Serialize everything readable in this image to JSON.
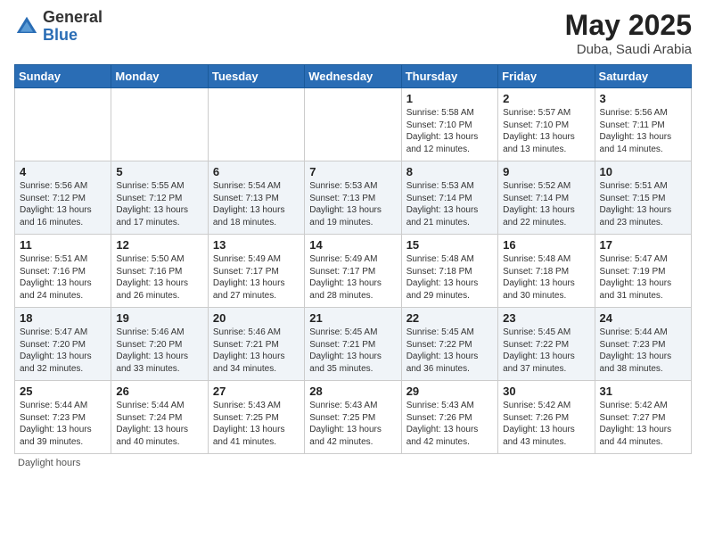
{
  "header": {
    "logo_general": "General",
    "logo_blue": "Blue",
    "month_title": "May 2025",
    "location": "Duba, Saudi Arabia"
  },
  "footer": {
    "daylight_label": "Daylight hours"
  },
  "days_of_week": [
    "Sunday",
    "Monday",
    "Tuesday",
    "Wednesday",
    "Thursday",
    "Friday",
    "Saturday"
  ],
  "weeks": [
    [
      {
        "num": "",
        "sunrise": "",
        "sunset": "",
        "daylight": ""
      },
      {
        "num": "",
        "sunrise": "",
        "sunset": "",
        "daylight": ""
      },
      {
        "num": "",
        "sunrise": "",
        "sunset": "",
        "daylight": ""
      },
      {
        "num": "",
        "sunrise": "",
        "sunset": "",
        "daylight": ""
      },
      {
        "num": "1",
        "sunrise": "5:58 AM",
        "sunset": "7:10 PM",
        "daylight": "13 hours and 12 minutes."
      },
      {
        "num": "2",
        "sunrise": "5:57 AM",
        "sunset": "7:10 PM",
        "daylight": "13 hours and 13 minutes."
      },
      {
        "num": "3",
        "sunrise": "5:56 AM",
        "sunset": "7:11 PM",
        "daylight": "13 hours and 14 minutes."
      }
    ],
    [
      {
        "num": "4",
        "sunrise": "5:56 AM",
        "sunset": "7:12 PM",
        "daylight": "13 hours and 16 minutes."
      },
      {
        "num": "5",
        "sunrise": "5:55 AM",
        "sunset": "7:12 PM",
        "daylight": "13 hours and 17 minutes."
      },
      {
        "num": "6",
        "sunrise": "5:54 AM",
        "sunset": "7:13 PM",
        "daylight": "13 hours and 18 minutes."
      },
      {
        "num": "7",
        "sunrise": "5:53 AM",
        "sunset": "7:13 PM",
        "daylight": "13 hours and 19 minutes."
      },
      {
        "num": "8",
        "sunrise": "5:53 AM",
        "sunset": "7:14 PM",
        "daylight": "13 hours and 21 minutes."
      },
      {
        "num": "9",
        "sunrise": "5:52 AM",
        "sunset": "7:14 PM",
        "daylight": "13 hours and 22 minutes."
      },
      {
        "num": "10",
        "sunrise": "5:51 AM",
        "sunset": "7:15 PM",
        "daylight": "13 hours and 23 minutes."
      }
    ],
    [
      {
        "num": "11",
        "sunrise": "5:51 AM",
        "sunset": "7:16 PM",
        "daylight": "13 hours and 24 minutes."
      },
      {
        "num": "12",
        "sunrise": "5:50 AM",
        "sunset": "7:16 PM",
        "daylight": "13 hours and 26 minutes."
      },
      {
        "num": "13",
        "sunrise": "5:49 AM",
        "sunset": "7:17 PM",
        "daylight": "13 hours and 27 minutes."
      },
      {
        "num": "14",
        "sunrise": "5:49 AM",
        "sunset": "7:17 PM",
        "daylight": "13 hours and 28 minutes."
      },
      {
        "num": "15",
        "sunrise": "5:48 AM",
        "sunset": "7:18 PM",
        "daylight": "13 hours and 29 minutes."
      },
      {
        "num": "16",
        "sunrise": "5:48 AM",
        "sunset": "7:18 PM",
        "daylight": "13 hours and 30 minutes."
      },
      {
        "num": "17",
        "sunrise": "5:47 AM",
        "sunset": "7:19 PM",
        "daylight": "13 hours and 31 minutes."
      }
    ],
    [
      {
        "num": "18",
        "sunrise": "5:47 AM",
        "sunset": "7:20 PM",
        "daylight": "13 hours and 32 minutes."
      },
      {
        "num": "19",
        "sunrise": "5:46 AM",
        "sunset": "7:20 PM",
        "daylight": "13 hours and 33 minutes."
      },
      {
        "num": "20",
        "sunrise": "5:46 AM",
        "sunset": "7:21 PM",
        "daylight": "13 hours and 34 minutes."
      },
      {
        "num": "21",
        "sunrise": "5:45 AM",
        "sunset": "7:21 PM",
        "daylight": "13 hours and 35 minutes."
      },
      {
        "num": "22",
        "sunrise": "5:45 AM",
        "sunset": "7:22 PM",
        "daylight": "13 hours and 36 minutes."
      },
      {
        "num": "23",
        "sunrise": "5:45 AM",
        "sunset": "7:22 PM",
        "daylight": "13 hours and 37 minutes."
      },
      {
        "num": "24",
        "sunrise": "5:44 AM",
        "sunset": "7:23 PM",
        "daylight": "13 hours and 38 minutes."
      }
    ],
    [
      {
        "num": "25",
        "sunrise": "5:44 AM",
        "sunset": "7:23 PM",
        "daylight": "13 hours and 39 minutes."
      },
      {
        "num": "26",
        "sunrise": "5:44 AM",
        "sunset": "7:24 PM",
        "daylight": "13 hours and 40 minutes."
      },
      {
        "num": "27",
        "sunrise": "5:43 AM",
        "sunset": "7:25 PM",
        "daylight": "13 hours and 41 minutes."
      },
      {
        "num": "28",
        "sunrise": "5:43 AM",
        "sunset": "7:25 PM",
        "daylight": "13 hours and 42 minutes."
      },
      {
        "num": "29",
        "sunrise": "5:43 AM",
        "sunset": "7:26 PM",
        "daylight": "13 hours and 42 minutes."
      },
      {
        "num": "30",
        "sunrise": "5:42 AM",
        "sunset": "7:26 PM",
        "daylight": "13 hours and 43 minutes."
      },
      {
        "num": "31",
        "sunrise": "5:42 AM",
        "sunset": "7:27 PM",
        "daylight": "13 hours and 44 minutes."
      }
    ]
  ]
}
